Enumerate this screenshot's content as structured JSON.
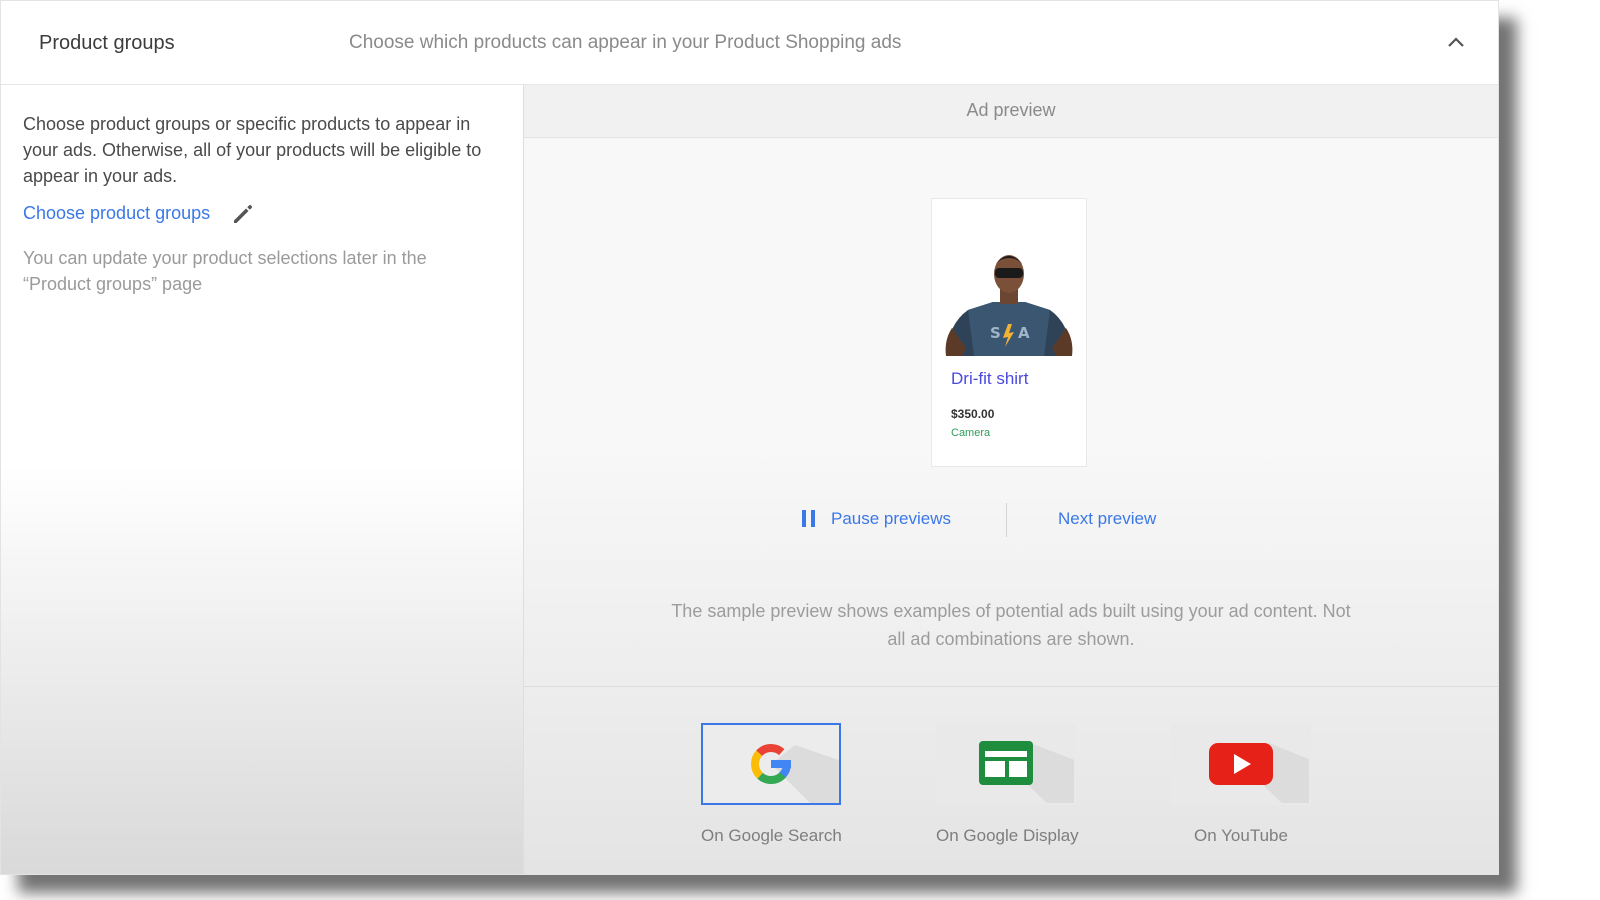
{
  "header": {
    "title": "Product groups",
    "subtitle": "Choose which products can appear in your Product Shopping ads",
    "collapse_icon": "chevron-up-icon"
  },
  "left": {
    "description": "Choose product groups or specific products to appear in your ads. Otherwise, all of your products will be eligible to appear in your ads.",
    "choose_link": "Choose product groups",
    "edit_icon": "pencil-icon",
    "note": "You can update your product selections later in the “Product groups” page"
  },
  "preview": {
    "heading": "Ad preview",
    "ad": {
      "product_name": "Dri-fit shirt",
      "price": "$350.00",
      "store": "Camera"
    },
    "pause_label": "Pause previews",
    "next_label": "Next preview",
    "note": "The sample preview shows examples of potential ads built using your ad content. Not all ad combinations are shown.",
    "channels": [
      {
        "label": "On Google Search",
        "icon": "google-g-icon",
        "selected": true
      },
      {
        "label": "On Google Display",
        "icon": "display-icon",
        "selected": false
      },
      {
        "label": "On YouTube",
        "icon": "youtube-icon",
        "selected": false
      }
    ]
  },
  "colors": {
    "link_blue": "#3b78e7",
    "product_name": "#4a4ae0",
    "store_green": "#2e9d58",
    "youtube_red": "#e62117",
    "display_green": "#1e8e3e"
  }
}
